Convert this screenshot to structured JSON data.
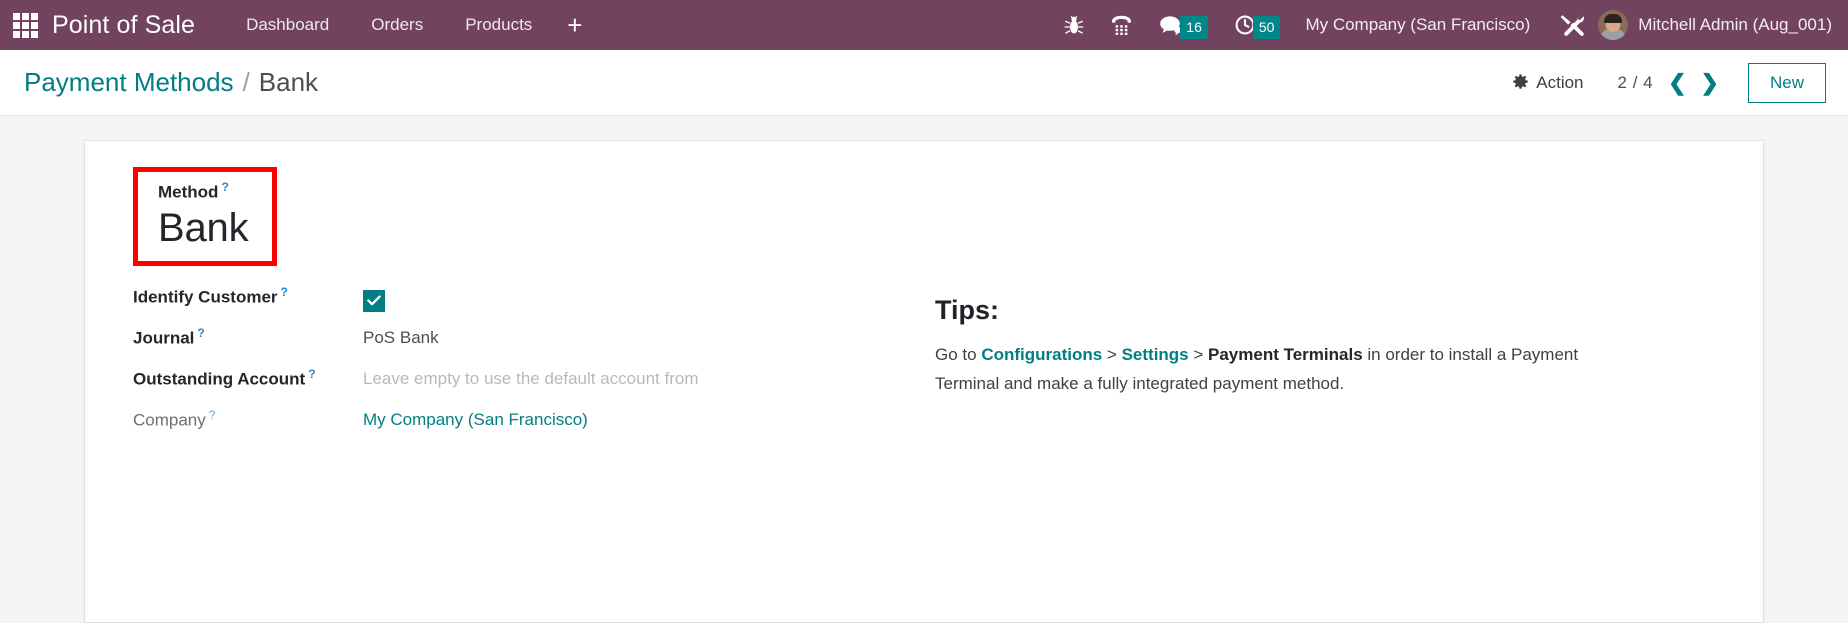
{
  "navbar": {
    "apps_icon": "apps-grid-icon",
    "brand": "Point of Sale",
    "menu": [
      {
        "label": "Dashboard"
      },
      {
        "label": "Orders"
      },
      {
        "label": "Products"
      }
    ],
    "add_label": "+",
    "system_icons": [
      {
        "name": "bug-icon"
      },
      {
        "name": "dialpad-icon"
      },
      {
        "name": "messages-icon",
        "badge": "16"
      },
      {
        "name": "activities-clock-icon",
        "badge": "50"
      }
    ],
    "company": "My Company (San Francisco)",
    "tools_icon": "tools-wrench-icon",
    "user": "Mitchell Admin (Aug_001)"
  },
  "control_panel": {
    "breadcrumb_root": "Payment Methods",
    "breadcrumb_separator": "/",
    "breadcrumb_current": "Bank",
    "action_label": "Action",
    "action_icon": "gear-icon",
    "pager": "2 / 4",
    "pager_prev_icon": "chevron-left-icon",
    "pager_next_icon": "chevron-right-icon",
    "new_label": "New"
  },
  "form": {
    "method": {
      "label": "Method",
      "help": "?",
      "value": "Bank",
      "highlight_color": "#ff0000"
    },
    "fields": [
      {
        "label": "Identify Customer",
        "help": "?",
        "type": "checkbox",
        "checked": true
      },
      {
        "label": "Journal",
        "help": "?",
        "type": "text",
        "value": "PoS Bank"
      },
      {
        "label": "Outstanding Account",
        "help": "?",
        "type": "placeholder",
        "value": "Leave empty to use the default account from"
      },
      {
        "label": "Company",
        "help": "?",
        "type": "link",
        "value": "My Company (San Francisco)",
        "muted_label": true
      }
    ]
  },
  "tips": {
    "title": "Tips:",
    "lead": "Go to ",
    "link_1": "Configurations",
    "sep_1": " > ",
    "link_2": "Settings",
    "sep_2": " > ",
    "bold_3": "Payment Terminals",
    "tail": " in order to install a Payment Terminal and make a fully integrated payment method."
  },
  "colors": {
    "navbar": "#71435f",
    "accent_teal": "#017e84",
    "badge_teal": "#00878a",
    "highlight_red": "#ff0000",
    "page_bg": "#f4f4f5"
  }
}
